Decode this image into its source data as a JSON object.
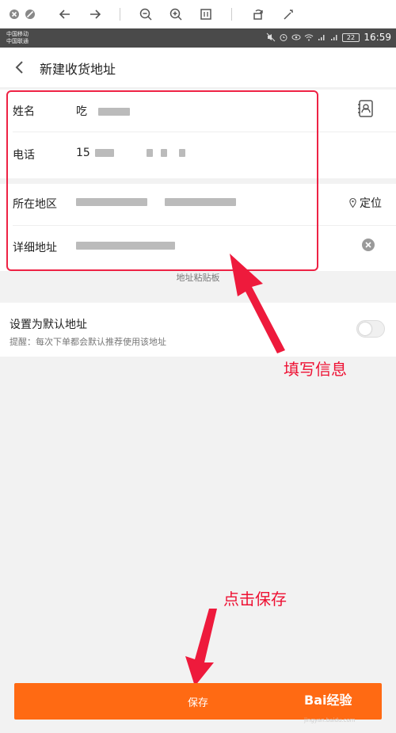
{
  "status_bar": {
    "carrier1": "中国移动",
    "carrier2": "中国联通",
    "battery": "22",
    "time": "16:59"
  },
  "header": {
    "title": "新建收货地址"
  },
  "form": {
    "name_label": "姓名",
    "name_value": "吃",
    "phone_label": "电话",
    "phone_value": "15",
    "region_label": "所在地区",
    "locate_label": "定位",
    "detail_label": "详细地址",
    "paste_hint": "地址粘贴板"
  },
  "default_setting": {
    "title": "设置为默认地址",
    "hint": "提醒：每次下单都会默认推荐使用该地址"
  },
  "annotations": {
    "fill_info": "填写信息",
    "click_save": "点击保存"
  },
  "save_button": "保存",
  "watermark": {
    "text": "Bai经验",
    "url": "jingyan.baidu.com"
  },
  "colors": {
    "accent": "#ff6a13",
    "annotation": "#ee1133"
  }
}
